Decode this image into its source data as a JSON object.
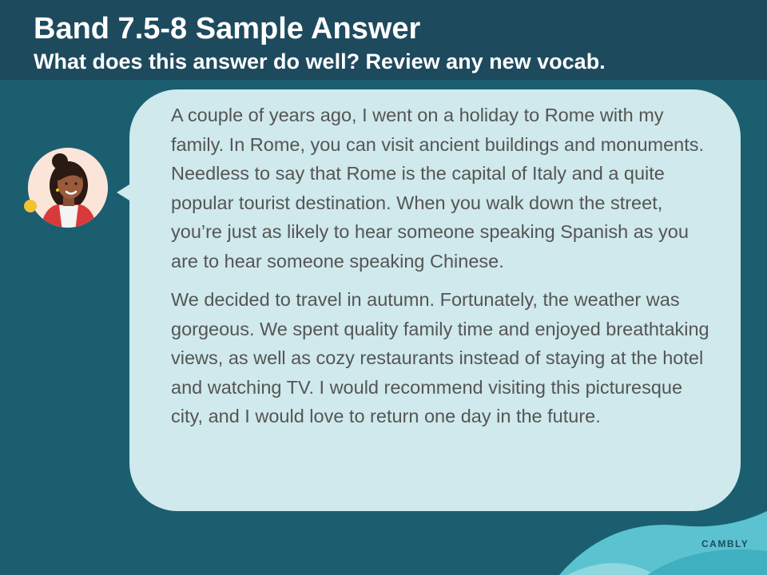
{
  "header": {
    "title": "Band 7.5-8 Sample Answer",
    "subtitle": "What does this answer do well? Review any new vocab."
  },
  "avatar": {
    "icon": "woman-avatar-icon"
  },
  "answer": {
    "paragraphs": [
      "A couple of years ago, I went on a holiday to Rome with my family. In Rome, you can visit ancient buildings and monuments. Needless to say that Rome is the capital of Italy and a quite popular tourist destination. When you walk down the street, you’re just as likely to hear someone speaking Spanish as you are to hear someone speaking Chinese.",
      "We decided to travel in autumn. Fortunately, the weather was gorgeous. We spent quality family time and enjoyed breathtaking views, as well as cozy restaurants instead of staying at the hotel and watching TV. I would recommend visiting this picturesque city, and I would love to return one day in the future."
    ]
  },
  "brand": {
    "logo_text": "CAMBLY"
  },
  "colors": {
    "background": "#1b5e70",
    "header": "#1e4a5e",
    "bubble": "#cfe9ec",
    "text": "#555555",
    "accent_wave": "#5bc3cf"
  }
}
